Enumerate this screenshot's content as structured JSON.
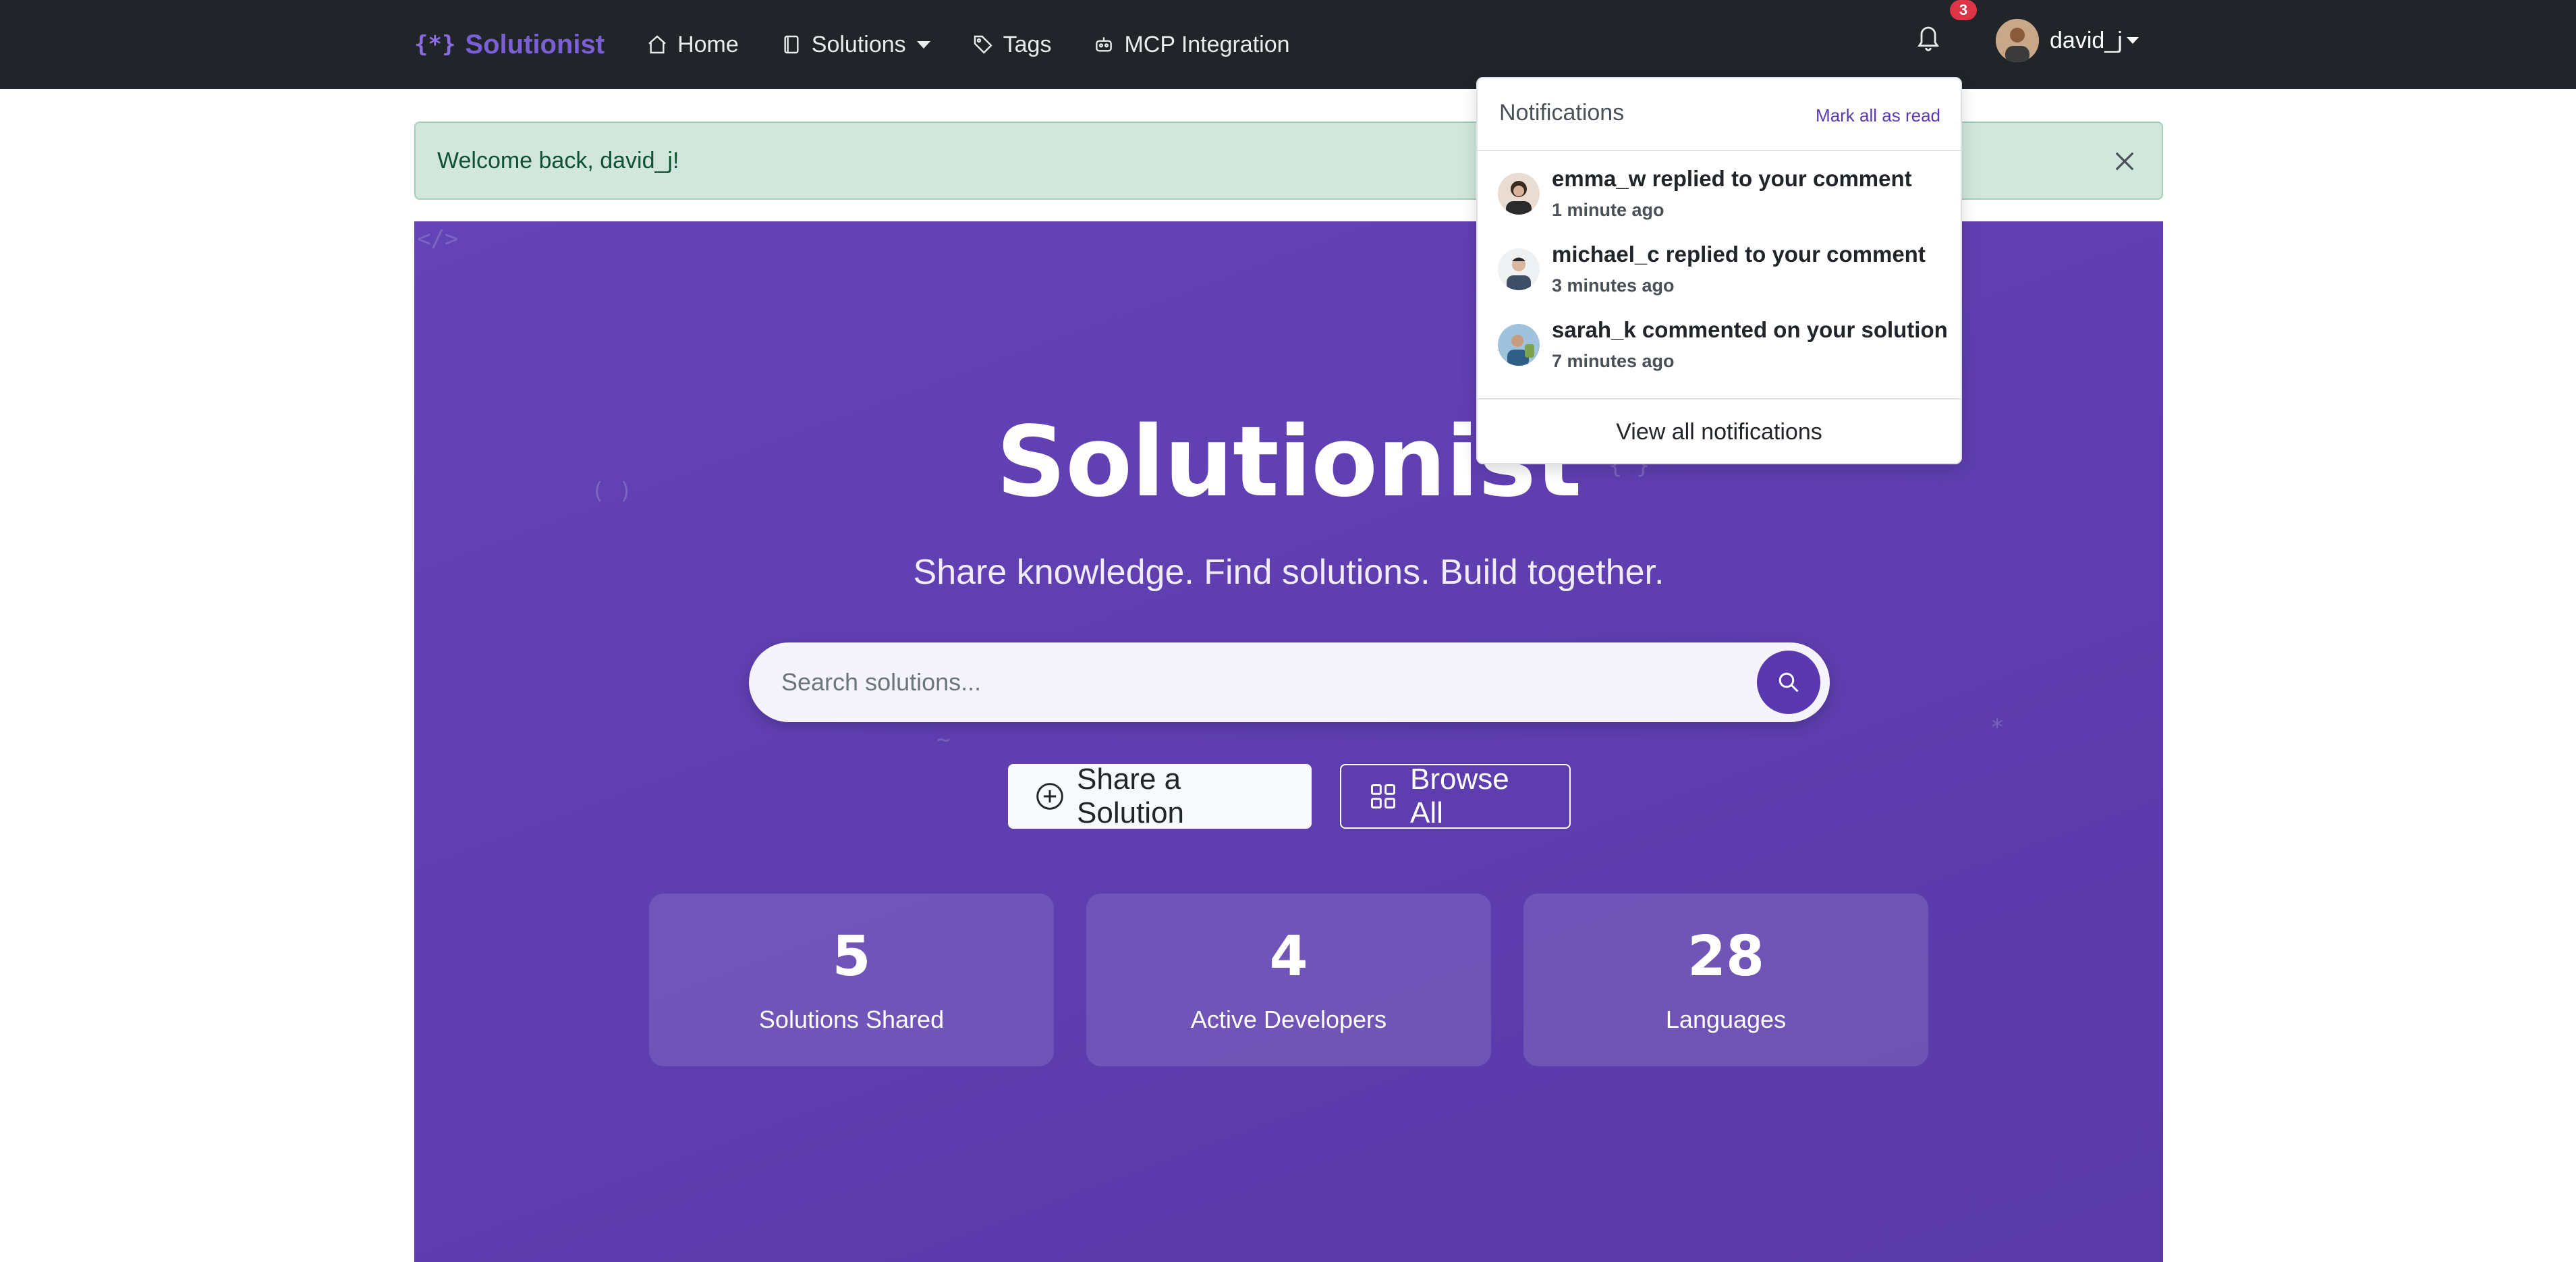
{
  "navbar": {
    "brand": "Solutionist",
    "brand_icon": "{*}",
    "links": {
      "home": "Home",
      "solutions": "Solutions",
      "tags": "Tags",
      "mcp": "MCP Integration"
    },
    "notification_count": "3",
    "username": "david_j"
  },
  "alert": {
    "message": "Welcome back, david_j!"
  },
  "hero": {
    "title": "Solutionist",
    "subtitle": "Share knowledge. Find solutions. Build together.",
    "search_placeholder": "Search solutions...",
    "share_button": "Share a Solution",
    "browse_button": "Browse All",
    "stats": [
      {
        "value": "5",
        "label": "Solutions Shared"
      },
      {
        "value": "4",
        "label": "Active Developers"
      },
      {
        "value": "28",
        "label": "Languages"
      }
    ]
  },
  "notifications": {
    "title": "Notifications",
    "mark_all": "Mark all as read",
    "items": [
      {
        "message": "emma_w replied to your comment",
        "time": "1 minute ago"
      },
      {
        "message": "michael_c replied to your comment",
        "time": "3 minutes ago"
      },
      {
        "message": "sarah_k commented on your solution",
        "time": "7 minutes ago"
      }
    ],
    "view_all": "View all notifications"
  },
  "colors": {
    "navbar_bg": "#212529",
    "brand": "#7b5fd6",
    "hero_bg": "#6443b7",
    "alert_bg": "#d1e7dd",
    "badge": "#dc3545",
    "search_button": "#5a38b0"
  }
}
